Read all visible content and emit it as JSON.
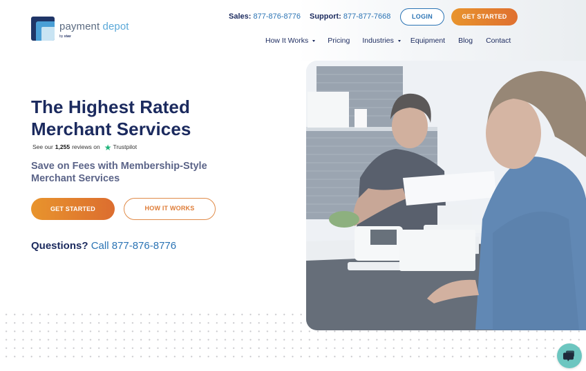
{
  "brand": {
    "name_part1": "payment ",
    "name_part2": "depot",
    "by_prefix": "by ",
    "by_brand": "stax",
    "colors": {
      "navy": "#1b2a5e",
      "blue": "#2a73b4",
      "orange": "#e8942d",
      "teal": "#6cc6c0",
      "trustpilot_green": "#1fb37a"
    }
  },
  "utility": {
    "sales_label": "Sales:",
    "sales_number": "877-876-8776",
    "support_label": "Support:",
    "support_number": "877-877-7668",
    "login_label": "LOGIN",
    "get_started_label": "GET STARTED"
  },
  "nav": {
    "items": [
      {
        "label": "How It Works",
        "dropdown": true
      },
      {
        "label": "Pricing",
        "dropdown": false
      },
      {
        "label": "Industries",
        "dropdown": true
      },
      {
        "label": "Equipment",
        "dropdown": false
      },
      {
        "label": "Blog",
        "dropdown": false
      },
      {
        "label": "Contact",
        "dropdown": false
      }
    ]
  },
  "hero": {
    "headline_line1": "The Highest Rated",
    "headline_line2": "Merchant Services",
    "reviews_prefix": "See our",
    "reviews_count": "1,255",
    "reviews_suffix": "reviews on",
    "reviews_site": "Trustpilot",
    "subhead_line1": "Save on Fees with Membership-Style",
    "subhead_line2": "Merchant Services",
    "get_started_label": "GET STARTED",
    "how_it_works_label": "HOW IT WORKS",
    "questions_label": "Questions?",
    "call_label": "Call 877-876-8776",
    "image_alt": "Cashier processing a card payment at a POS terminal for a customer"
  },
  "chat": {
    "icon": "chat-bubbles-icon"
  }
}
